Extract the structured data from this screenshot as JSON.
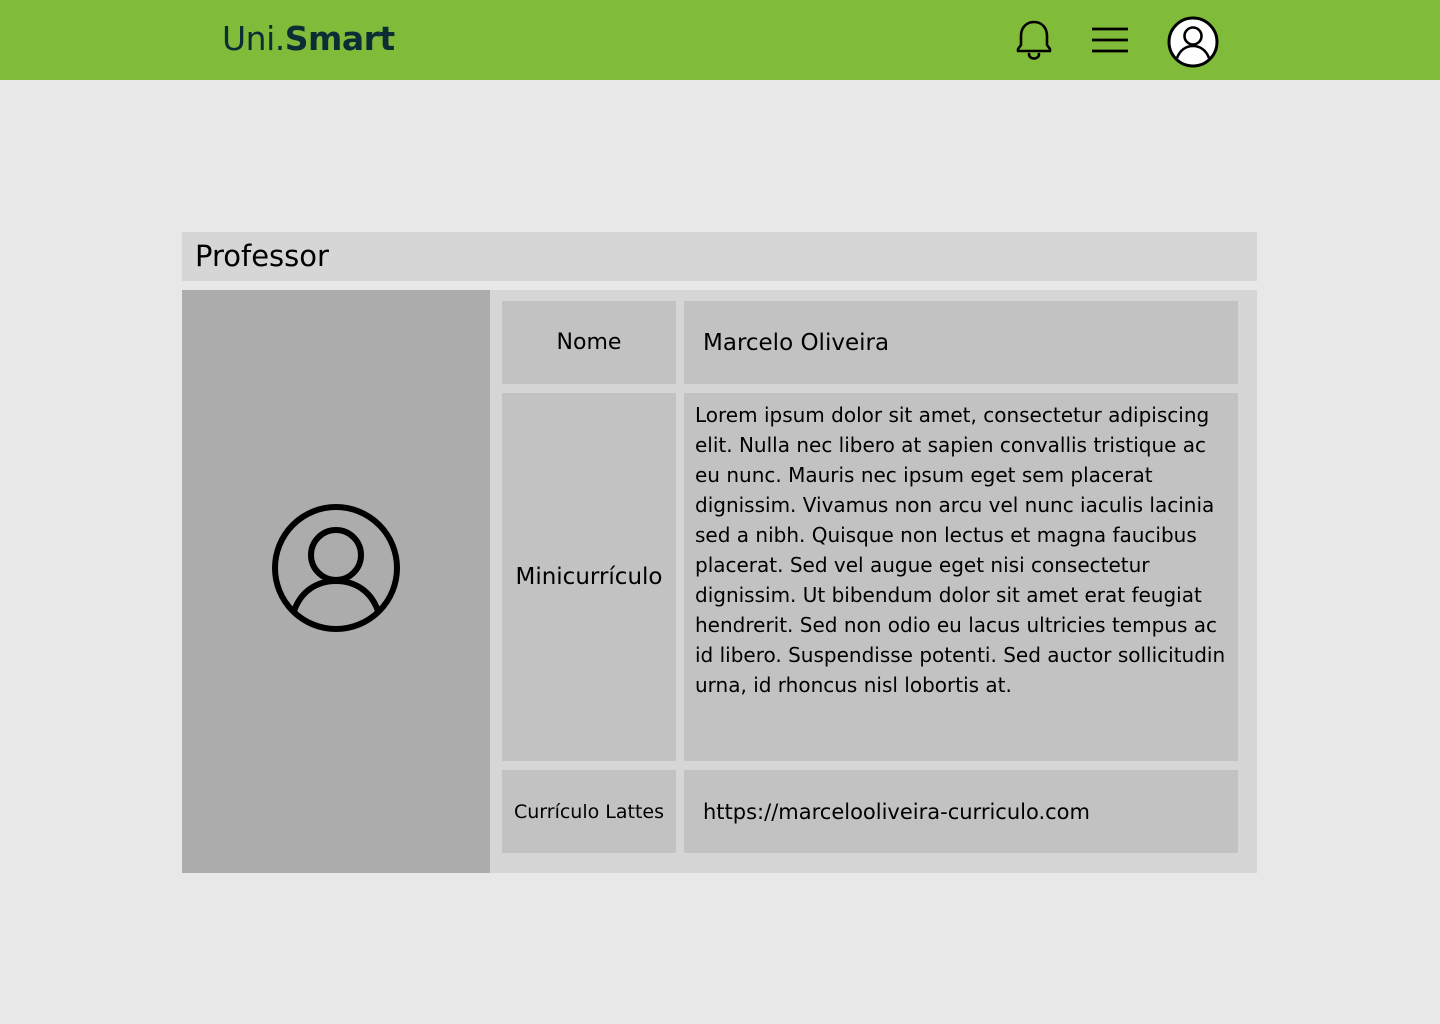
{
  "header": {
    "brand_prefix": "Uni.",
    "brand_strong": "Smart",
    "icons": [
      "bell-icon",
      "menu-icon",
      "account-icon"
    ],
    "colors": {
      "bar": "#80bc3a",
      "brand_text": "#0d2d34"
    }
  },
  "section": {
    "title": "Professor"
  },
  "profile": {
    "photo_icon": "user-avatar-icon",
    "fields": {
      "name_label": "Nome",
      "name_value": "Marcelo Oliveira",
      "bio_label": "Minicurrículo",
      "bio_value": "Lorem ipsum dolor sit amet, consectetur adipiscing elit. Nulla nec  libero at sapien convallis tristique ac eu nunc. Mauris nec ipsum eget  sem placerat dignissim. Vivamus non arcu vel nunc iaculis lacinia sed a  nibh. Quisque non lectus et magna faucibus placerat. Sed vel augue eget  nisi consectetur dignissim. Ut bibendum dolor sit amet erat feugiat hendrerit. Sed non odio eu lacus ultricies tempus ac id libero.  Suspendisse potenti. Sed auctor sollicitudin urna, id rhoncus nisl  lobortis at.",
      "lattes_label": "Currículo Lattes",
      "lattes_value": "https://marcelooliveira-curriculo.com"
    }
  }
}
